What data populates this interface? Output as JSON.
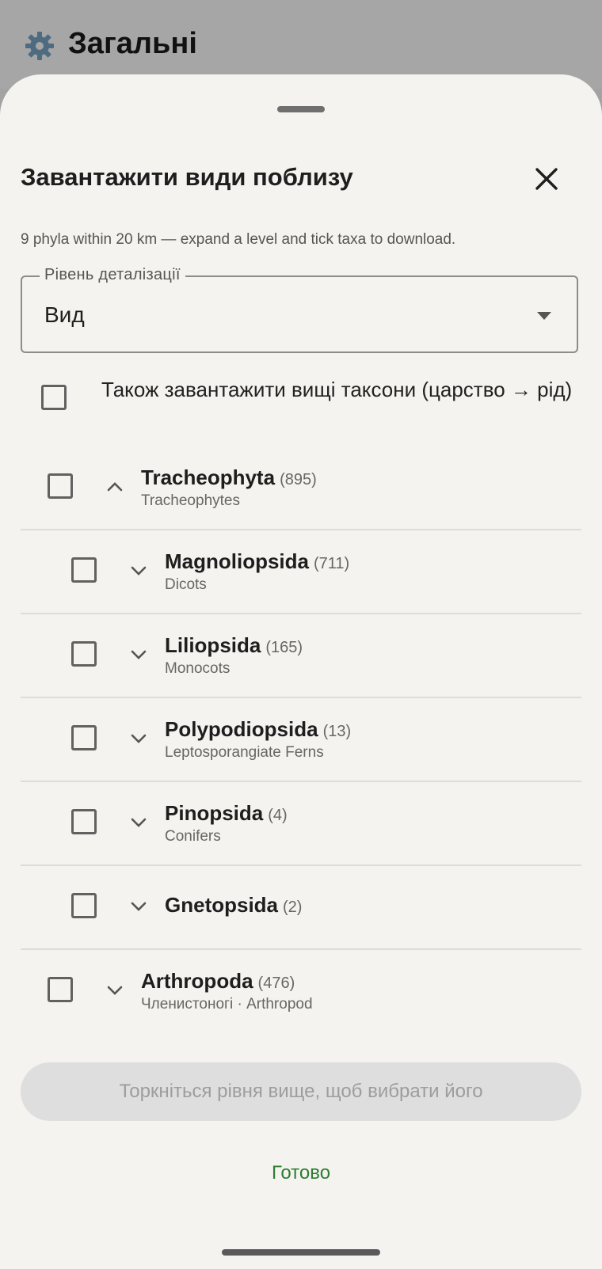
{
  "background": {
    "title": "Загальні",
    "icon": "gear-icon"
  },
  "sheet": {
    "title": "Завантажити види поблизу",
    "subtitle": "9 phyla within 20 km — expand a level and tick taxa to download.",
    "level_select": {
      "label": "Рівень деталізації",
      "value": "Вид"
    },
    "higher_taxa_checkbox": {
      "label": "Також завантажити вищі таксони (царство → рід)",
      "checked": false
    },
    "taxa": [
      {
        "name": "Tracheophyta",
        "count": "(895)",
        "common": "Tracheophytes",
        "expanded": true
      },
      {
        "name": "Magnoliopsida",
        "count": "(711)",
        "common": "Dicots",
        "expanded": false
      },
      {
        "name": "Liliopsida",
        "count": "(165)",
        "common": "Monocots",
        "expanded": false
      },
      {
        "name": "Polypodiopsida",
        "count": "(13)",
        "common": "Leptosporangiate Ferns",
        "expanded": false
      },
      {
        "name": "Pinopsida",
        "count": "(4)",
        "common": "Conifers",
        "expanded": false
      },
      {
        "name": "Gnetopsida",
        "count": "(2)",
        "common": "",
        "expanded": false
      },
      {
        "name": "Arthropoda",
        "count": "(476)",
        "common": "Членистоногі · Arthropod",
        "expanded": false
      }
    ],
    "action_button": "Торкніться рівня вище, щоб вибрати його",
    "done_button": "Готово"
  },
  "colors": {
    "accent": "#2e7d32",
    "sheet_bg": "#f4f3ef",
    "scrim": "#a6a6a6"
  }
}
